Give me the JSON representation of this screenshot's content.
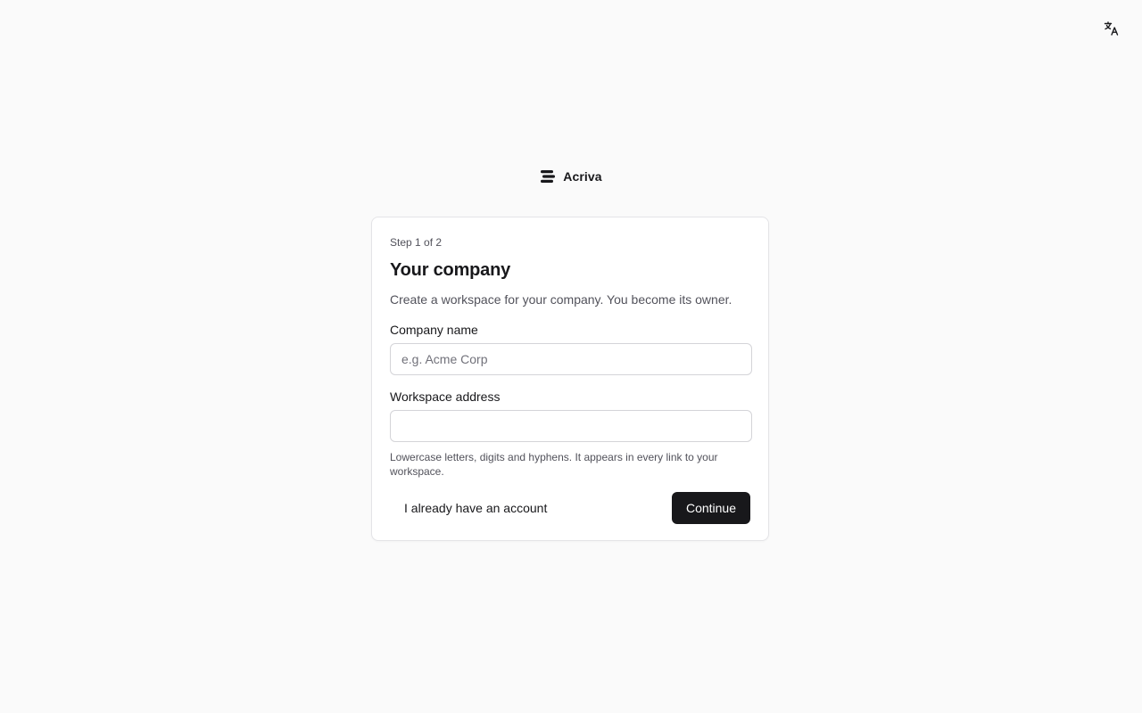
{
  "header": {
    "language_icon": "translate-icon"
  },
  "brand": {
    "logo_icon": "stacked-bars-logo-icon",
    "name": "Acriva"
  },
  "card": {
    "step": "Step 1 of 2",
    "title": "Your company",
    "subtitle": "Create a workspace for your company. You become its owner.",
    "company_field": {
      "label": "Company name",
      "value": "",
      "placeholder": "e.g. Acme Corp"
    },
    "workspace_field": {
      "label": "Workspace address",
      "value": "",
      "placeholder": ""
    },
    "hint": "Lowercase letters, digits and hyphens. It appears in every link to your workspace.",
    "actions": {
      "secondary_label": "I already have an account",
      "primary_label": "Continue"
    }
  },
  "colors": {
    "background": "#fafafa",
    "card": "#ffffff",
    "primary": "#18181b",
    "muted_text": "#52525b",
    "border": "#d4d4d8"
  }
}
